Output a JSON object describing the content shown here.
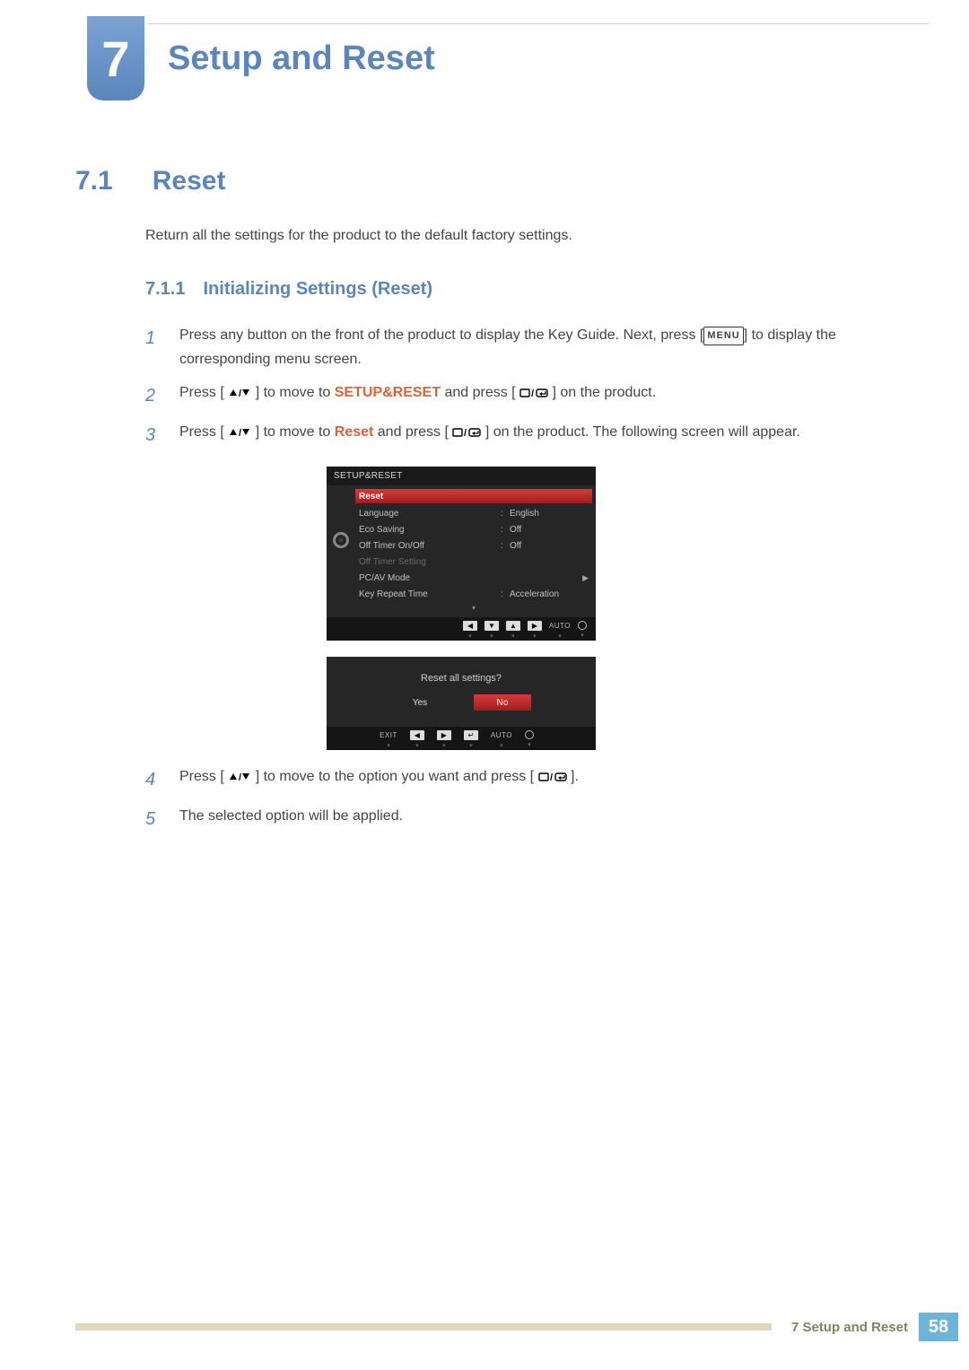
{
  "chapter": {
    "number": "7",
    "title": "Setup and Reset"
  },
  "section": {
    "number": "7.1",
    "title": "Reset"
  },
  "intro": "Return all the settings for the product to the default factory settings.",
  "subsection": {
    "number": "7.1.1",
    "title": "Initializing Settings (Reset)"
  },
  "steps": {
    "s1": {
      "num": "1",
      "pre": "Press any button on the front of the product to display the Key Guide. Next, press [",
      "menu": "MENU",
      "post": "] to display the corresponding menu screen."
    },
    "s2": {
      "num": "2",
      "a": "Press [",
      "b": "] to move to ",
      "kw": "SETUP&RESET",
      "c": " and press [",
      "d": "] on the product."
    },
    "s3": {
      "num": "3",
      "a": "Press [",
      "b": "] to move to ",
      "kw": "Reset",
      "c": " and press [",
      "d": "] on the product. The following screen will appear."
    },
    "s4": {
      "num": "4",
      "a": "Press [",
      "b": "] to move to the option you want and press [",
      "c": "]."
    },
    "s5": {
      "num": "5",
      "text": "The selected option will be applied."
    }
  },
  "osd": {
    "title": "SETUP&RESET",
    "items": [
      {
        "label": "Reset",
        "value": "",
        "selected": true
      },
      {
        "label": "Language",
        "value": "English"
      },
      {
        "label": "Eco Saving",
        "value": "Off"
      },
      {
        "label": "Off Timer On/Off",
        "value": "Off"
      },
      {
        "label": "Off Timer Setting",
        "value": "",
        "dim": true
      },
      {
        "label": "PC/AV Mode",
        "value": "",
        "arrow": true
      },
      {
        "label": "Key Repeat Time",
        "value": "Acceleration"
      }
    ],
    "footer_auto": "AUTO"
  },
  "confirm": {
    "question": "Reset all settings?",
    "yes": "Yes",
    "no": "No",
    "exit": "EXIT",
    "auto": "AUTO"
  },
  "footer": {
    "label": "7 Setup and Reset",
    "page": "58"
  }
}
